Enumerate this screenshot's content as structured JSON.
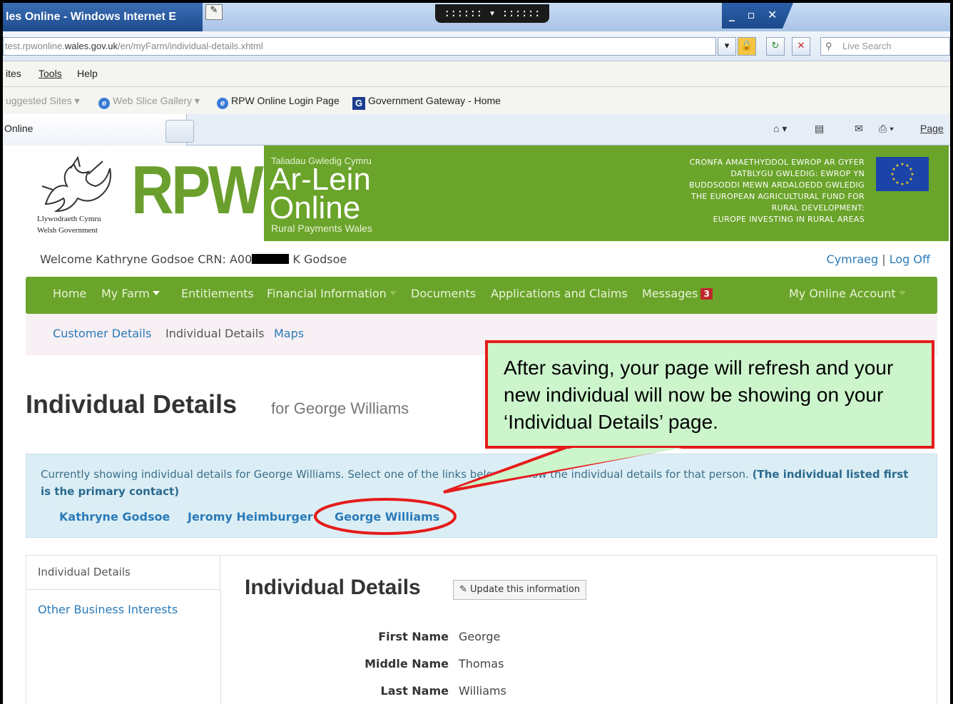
{
  "browser": {
    "title": "les Online - Windows Internet E",
    "url_prefix": "test.rpwonline.",
    "url_domain": "wales.gov.uk",
    "url_path": "/en/myFarm/individual-details.xhtml",
    "search_placeholder": "Live Search",
    "menu": [
      "ites",
      "Tools",
      "Help"
    ],
    "favorites": {
      "suggested": "uggested Sites",
      "web_slice": "Web Slice Gallery",
      "rpw_login": "RPW Online Login Page",
      "gov_gateway": "Government Gateway - Home"
    },
    "tab_label": "Online",
    "toolbar_page": "Page"
  },
  "banner": {
    "wg_welsh": "Llywodraeth Cymru",
    "wg_english": "Welsh Government",
    "rpw": "RPW",
    "taliadau": "Taliadau Gwledig Cymru",
    "ar_lein": "Ar-Lein",
    "online": "Online",
    "rural_payments": "Rural Payments Wales",
    "eu_welsh_1": "CRONFA AMAETHYDDOL EWROP AR GYFER",
    "eu_welsh_2": "DATBLYGU GWLEDIG: EWROP YN",
    "eu_welsh_3": "BUDDSODDI MEWN ARDALOEDD GWLEDIG",
    "eu_english_1": "THE EUROPEAN AGRICULTURAL FUND FOR",
    "eu_english_2": "RURAL DEVELOPMENT:",
    "eu_english_3": "EUROPE INVESTING IN RURAL AREAS"
  },
  "header": {
    "welcome_prefix": "Welcome Kathryne Godsoe CRN: A00",
    "welcome_suffix": "K Godsoe",
    "cymraeg": "Cymraeg",
    "separator": "|",
    "logoff": "Log Off"
  },
  "nav": {
    "home": "Home",
    "my_farm": "My Farm",
    "entitlements": "Entitlements",
    "financial": "Financial Information",
    "documents": "Documents",
    "applications": "Applications and Claims",
    "messages": "Messages",
    "messages_count": "3",
    "account": "My Online Account"
  },
  "subnav": {
    "customer": "Customer Details",
    "individual": "Individual Details",
    "maps": "Maps"
  },
  "page": {
    "title": "Individual Details",
    "for": "for George Williams"
  },
  "info": {
    "text": "Currently showing individual details for George Williams. Select one of the links below to show the individual details for that person.",
    "bold": "(The individual listed first is the primary contact)",
    "people": [
      "Kathryne Godsoe",
      "Jeromy Heimburger",
      "George Williams"
    ]
  },
  "details": {
    "side_active": "Individual Details",
    "side_other": "Other Business Interests",
    "heading": "Individual Details",
    "update_button": "Update this information",
    "fields": [
      {
        "label": "First Name",
        "value": "George"
      },
      {
        "label": "Middle Name",
        "value": "Thomas"
      },
      {
        "label": "Last Name",
        "value": "Williams"
      }
    ]
  },
  "callout": {
    "text": "After saving, your page will refresh and your new individual will now be showing on your ‘Individual Details’ page."
  },
  "colors": {
    "rpw_green": "#6aa42a",
    "link_blue": "#2a7ab8",
    "annotation_red": "#e61b1b",
    "callout_fill": "#ccf5cc"
  }
}
